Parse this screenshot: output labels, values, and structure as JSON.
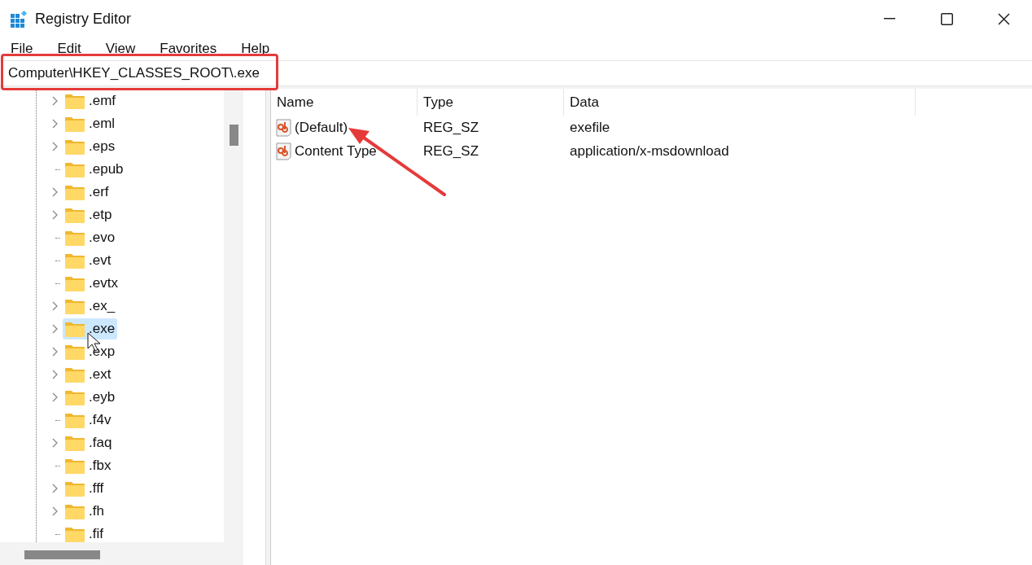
{
  "window": {
    "title": "Registry Editor"
  },
  "menu": [
    "File",
    "Edit",
    "View",
    "Favorites",
    "Help"
  ],
  "address": {
    "value": "Computer\\HKEY_CLASSES_ROOT\\.exe",
    "highlighted": true
  },
  "tree": [
    {
      "name": ".emf",
      "expandable": true,
      "selected": false
    },
    {
      "name": ".eml",
      "expandable": true,
      "selected": false
    },
    {
      "name": ".eps",
      "expandable": true,
      "selected": false
    },
    {
      "name": ".epub",
      "expandable": false,
      "selected": false
    },
    {
      "name": ".erf",
      "expandable": true,
      "selected": false
    },
    {
      "name": ".etp",
      "expandable": true,
      "selected": false
    },
    {
      "name": ".evo",
      "expandable": false,
      "selected": false
    },
    {
      "name": ".evt",
      "expandable": false,
      "selected": false
    },
    {
      "name": ".evtx",
      "expandable": false,
      "selected": false
    },
    {
      "name": ".ex_",
      "expandable": true,
      "selected": false
    },
    {
      "name": ".exe",
      "expandable": true,
      "selected": true
    },
    {
      "name": ".exp",
      "expandable": true,
      "selected": false
    },
    {
      "name": ".ext",
      "expandable": true,
      "selected": false
    },
    {
      "name": ".eyb",
      "expandable": true,
      "selected": false
    },
    {
      "name": ".f4v",
      "expandable": false,
      "selected": false
    },
    {
      "name": ".faq",
      "expandable": true,
      "selected": false
    },
    {
      "name": ".fbx",
      "expandable": false,
      "selected": false
    },
    {
      "name": ".fff",
      "expandable": true,
      "selected": false
    },
    {
      "name": ".fh",
      "expandable": true,
      "selected": false
    },
    {
      "name": ".fif",
      "expandable": false,
      "selected": false
    }
  ],
  "table": {
    "columns": [
      "Name",
      "Type",
      "Data"
    ],
    "rows": [
      {
        "name": "(Default)",
        "type": "REG_SZ",
        "data": "exefile"
      },
      {
        "name": "Content Type",
        "type": "REG_SZ",
        "data": "application/x-msdownload"
      }
    ]
  },
  "annotation": {
    "kind": "arrow"
  }
}
